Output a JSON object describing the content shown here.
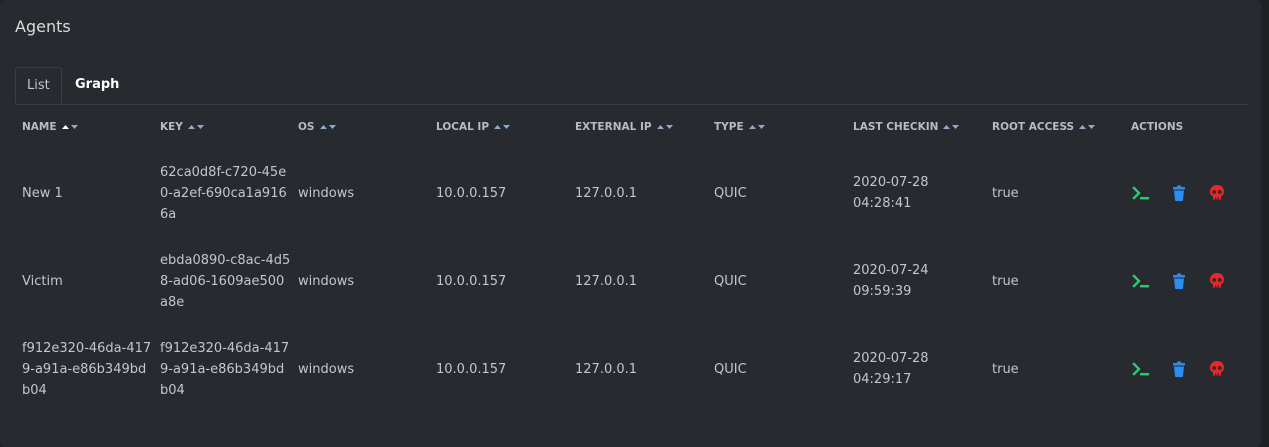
{
  "panel": {
    "title": "Agents"
  },
  "tabs": [
    {
      "label": "List",
      "active": true
    },
    {
      "label": "Graph",
      "active": false
    }
  ],
  "table": {
    "columns": [
      {
        "label": "NAME",
        "sortable": true,
        "sorted": "asc"
      },
      {
        "label": "KEY",
        "sortable": true
      },
      {
        "label": "OS",
        "sortable": true
      },
      {
        "label": "LOCAL IP",
        "sortable": true
      },
      {
        "label": "EXTERNAL IP",
        "sortable": true
      },
      {
        "label": "TYPE",
        "sortable": true
      },
      {
        "label": "LAST CHECKIN",
        "sortable": true
      },
      {
        "label": "ROOT ACCESS",
        "sortable": true
      },
      {
        "label": "ACTIONS",
        "sortable": false
      }
    ],
    "rows": [
      {
        "name": "New 1",
        "key": "62ca0d8f-c720-45e0-a2ef-690ca1a9166a",
        "os": "windows",
        "local_ip": "10.0.0.157",
        "external_ip": "127.0.0.1",
        "type": "QUIC",
        "last_checkin_date": "2020-07-28",
        "last_checkin_time": "04:28:41",
        "root_access": "true"
      },
      {
        "name": "Victim",
        "key": "ebda0890-c8ac-4d58-ad06-1609ae500a8e",
        "os": "windows",
        "local_ip": "10.0.0.157",
        "external_ip": "127.0.0.1",
        "type": "QUIC",
        "last_checkin_date": "2020-07-24",
        "last_checkin_time": "09:59:39",
        "root_access": "true"
      },
      {
        "name": "f912e320-46da-4179-a91a-e86b349bdb04",
        "key": "f912e320-46da-4179-a91a-e86b349bdb04",
        "os": "windows",
        "local_ip": "10.0.0.157",
        "external_ip": "127.0.0.1",
        "type": "QUIC",
        "last_checkin_date": "2020-07-28",
        "last_checkin_time": "04:29:17",
        "root_access": "true"
      }
    ],
    "actions": [
      {
        "icon": "terminal-icon",
        "color": "#2ecc71"
      },
      {
        "icon": "trash-icon",
        "color": "#2d8cf0"
      },
      {
        "icon": "skull-icon",
        "color": "#e8272b"
      }
    ]
  },
  "colors": {
    "background": "#1e2023",
    "panel": "#272a2e",
    "sort_arrow": "#8fa9c9",
    "sort_arrow_active": "#ffffff"
  }
}
